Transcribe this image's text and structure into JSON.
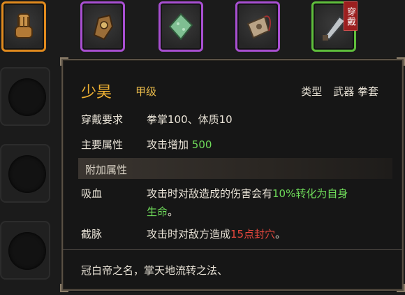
{
  "inventory": {
    "slots": [
      {
        "rarity": "orange",
        "icon": "gauntlet-icon",
        "color": "#e08a1e"
      },
      {
        "rarity": "purple",
        "icon": "glove-icon",
        "color": "#a84fd1"
      },
      {
        "rarity": "purple",
        "icon": "jade-stone-icon",
        "color": "#a84fd1"
      },
      {
        "rarity": "purple",
        "icon": "pouch-icon",
        "color": "#a84fd1"
      },
      {
        "rarity": "green",
        "icon": "blade-icon",
        "color": "#5fbf3c",
        "badge": "穿戴"
      }
    ]
  },
  "tooltip": {
    "name": "少昊",
    "grade": "甲级",
    "type_label": "类型",
    "type_value": "武器 拳套",
    "requirement": {
      "label": "穿戴要求",
      "value": "拳掌100、体质10"
    },
    "main_attr": {
      "label": "主要属性",
      "prefix": "攻击增加 ",
      "amount": "500"
    },
    "extra_header": "附加属性",
    "extras": [
      {
        "label": "吸血",
        "pre": "攻击时对敌造成的伤害会有",
        "hl": "10%转化为自身",
        "line2": "生命",
        "post": "。"
      },
      {
        "label": "截脉",
        "pre": "攻击时对敌方造成",
        "hl": "15点封穴",
        "post": "。"
      }
    ],
    "description": "冠白帝之名，掌天地流转之法、"
  },
  "colors": {
    "name": "#f0b233",
    "positive": "#6fdc5a",
    "negative": "#e8483e"
  }
}
